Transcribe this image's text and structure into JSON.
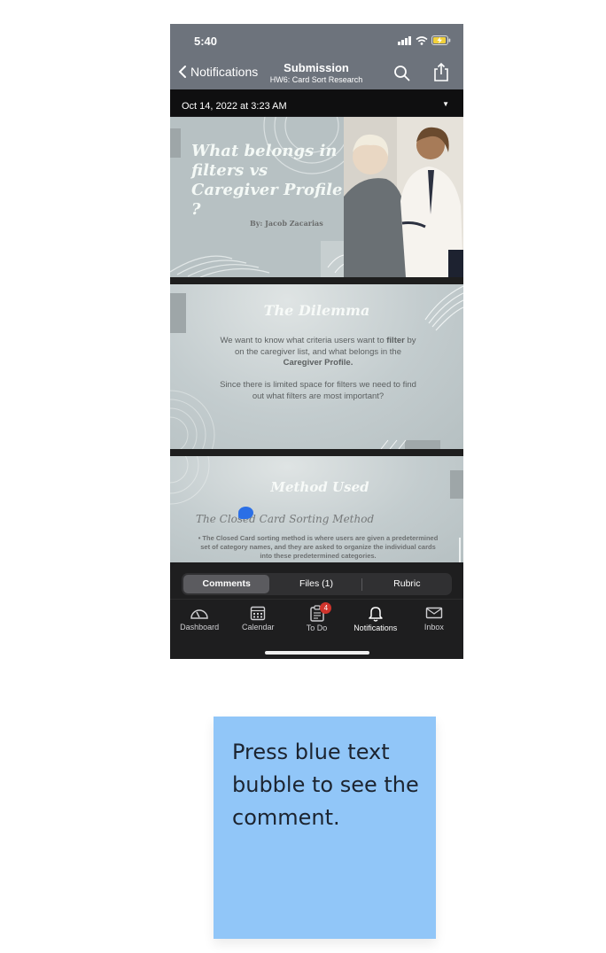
{
  "status_bar": {
    "time": "5:40"
  },
  "nav": {
    "back_label": "Notifications",
    "title": "Submission",
    "subtitle": "HW6: Card Sort Research"
  },
  "submission": {
    "date": "Oct 14, 2022 at 3:23 AM"
  },
  "slides": {
    "slide1": {
      "title": "What belongs in filters vs Caregiver Profile ?",
      "author": "By: Jacob Zacarias"
    },
    "slide2": {
      "title": "The Dilemma",
      "para1_a": "We want to know what criteria users want to ",
      "para1_b": "filter",
      "para1_c": " by on the caregiver list, and what belongs in the ",
      "para1_d": "Caregiver Profile.",
      "para2": "Since there is limited space for filters we need to find out what filters are most important?"
    },
    "slide3": {
      "title": "Method Used",
      "subtitle": "The Closed Card Sorting Method",
      "bullet": "The Closed Card sorting method is where users are given a predetermined set of category names, and they are asked to organize the individual cards into these predetermined categories."
    }
  },
  "segments": [
    {
      "label": "Comments",
      "active": true
    },
    {
      "label": "Files (1)",
      "active": false
    },
    {
      "label": "Rubric",
      "active": false
    }
  ],
  "tab_bar": {
    "dashboard": "Dashboard",
    "calendar": "Calendar",
    "todo": "To Do",
    "todo_badge": "4",
    "notifications": "Notifications",
    "inbox": "Inbox"
  },
  "note": {
    "text": "Press blue text bubble to see the comment."
  },
  "colors": {
    "nav_gray": "#6d737c",
    "comment_bubble": "#2b6fe6",
    "badge_red": "#d0342c",
    "note_blue": "#91c6f8"
  }
}
